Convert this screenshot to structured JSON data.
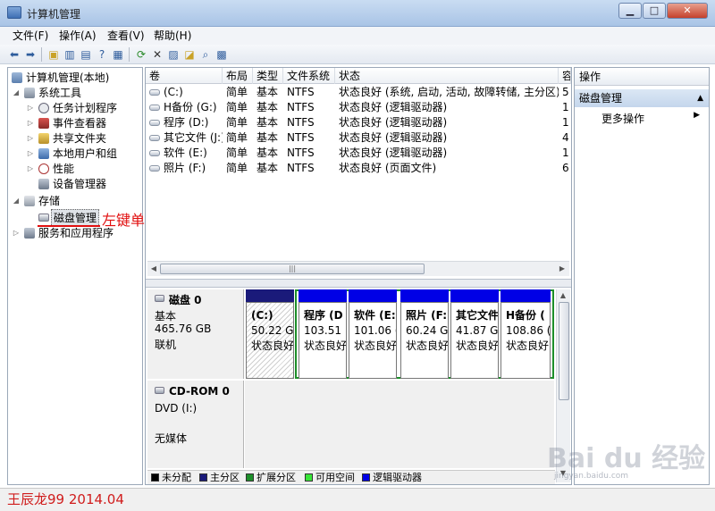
{
  "window": {
    "title": "计算机管理"
  },
  "colors": {
    "unallocated": "#000000",
    "primary": "#1a1a7a",
    "extended": "#1d8f2a",
    "free": "#39e639",
    "logical": "#0000e6",
    "annotation": "#e10f0f"
  },
  "menu": [
    "文件(F)",
    "操作(A)",
    "查看(V)",
    "帮助(H)"
  ],
  "toolbar_icons": [
    "back-arrow-icon",
    "forward-arrow-icon",
    "up-folder-icon",
    "show-hide-tree-icon",
    "properties-icon",
    "help-icon",
    "refresh-icon",
    "delete-icon",
    "properties-sheet-icon",
    "open-icon",
    "search-icon",
    "export-icon"
  ],
  "tree": [
    {
      "label": "计算机管理(本地)",
      "arrow": "",
      "level": 0
    },
    {
      "label": "系统工具",
      "arrow": "◢",
      "level": 1
    },
    {
      "label": "任务计划程序",
      "arrow": "▷",
      "level": 2
    },
    {
      "label": "事件查看器",
      "arrow": "▷",
      "level": 2
    },
    {
      "label": "共享文件夹",
      "arrow": "▷",
      "level": 2
    },
    {
      "label": "本地用户和组",
      "arrow": "▷",
      "level": 2
    },
    {
      "label": "性能",
      "arrow": "▷",
      "level": 2
    },
    {
      "label": "设备管理器",
      "arrow": "",
      "level": 2
    },
    {
      "label": "存储",
      "arrow": "◢",
      "level": 1
    },
    {
      "label": "磁盘管理",
      "arrow": "",
      "level": 2,
      "selected": true
    },
    {
      "label": "服务和应用程序",
      "arrow": "▷",
      "level": 1
    }
  ],
  "annotation": "左键单击",
  "volumes": {
    "columns": [
      "卷",
      "布局",
      "类型",
      "文件系统",
      "状态",
      "容"
    ],
    "rows": [
      {
        "name": "(C:)",
        "layout": "简单",
        "type": "基本",
        "fs": "NTFS",
        "status": "状态良好 (系统, 启动, 活动, 故障转储, 主分区)",
        "cap": "5"
      },
      {
        "name": "H备份 (G:)",
        "layout": "简单",
        "type": "基本",
        "fs": "NTFS",
        "status": "状态良好 (逻辑驱动器)",
        "cap": "1"
      },
      {
        "name": "程序 (D:)",
        "layout": "简单",
        "type": "基本",
        "fs": "NTFS",
        "status": "状态良好 (逻辑驱动器)",
        "cap": "1"
      },
      {
        "name": "其它文件 (J:)",
        "layout": "简单",
        "type": "基本",
        "fs": "NTFS",
        "status": "状态良好 (逻辑驱动器)",
        "cap": "4"
      },
      {
        "name": "软件 (E:)",
        "layout": "简单",
        "type": "基本",
        "fs": "NTFS",
        "status": "状态良好 (逻辑驱动器)",
        "cap": "1"
      },
      {
        "name": "照片 (F:)",
        "layout": "简单",
        "type": "基本",
        "fs": "NTFS",
        "status": "状态良好 (页面文件)",
        "cap": "6"
      }
    ]
  },
  "disk0": {
    "name": "磁盘 0",
    "type": "基本",
    "size": "465.76 GB",
    "state": "联机",
    "partitions": [
      {
        "name": "(C:)",
        "size": "50.22 G",
        "status": "状态良好",
        "kind": "primary"
      },
      {
        "name": "程序 (D",
        "size": "103.51",
        "status": "状态良好",
        "kind": "logical"
      },
      {
        "name": "软件 (E:",
        "size": "101.06 (",
        "status": "状态良好",
        "kind": "logical"
      },
      {
        "name": "照片 (F:",
        "size": "60.24 G",
        "status": "状态良好",
        "kind": "logical"
      },
      {
        "name": "其它文件",
        "size": "41.87 G",
        "status": "状态良好",
        "kind": "logical"
      },
      {
        "name": "H备份 (",
        "size": "108.86 (",
        "status": "状态良好",
        "kind": "logical"
      }
    ]
  },
  "cdrom": {
    "name": "CD-ROM 0",
    "drive": "DVD (I:)",
    "media": "无媒体"
  },
  "legend": [
    "未分配",
    "主分区",
    "扩展分区",
    "可用空间",
    "逻辑驱动器"
  ],
  "actions": {
    "title": "操作",
    "section": "磁盘管理",
    "more": "更多操作"
  },
  "footer": {
    "author": "王辰龙99 2014.04",
    "logo": "Bai du 经验",
    "url": "jingyan.baidu.com"
  }
}
